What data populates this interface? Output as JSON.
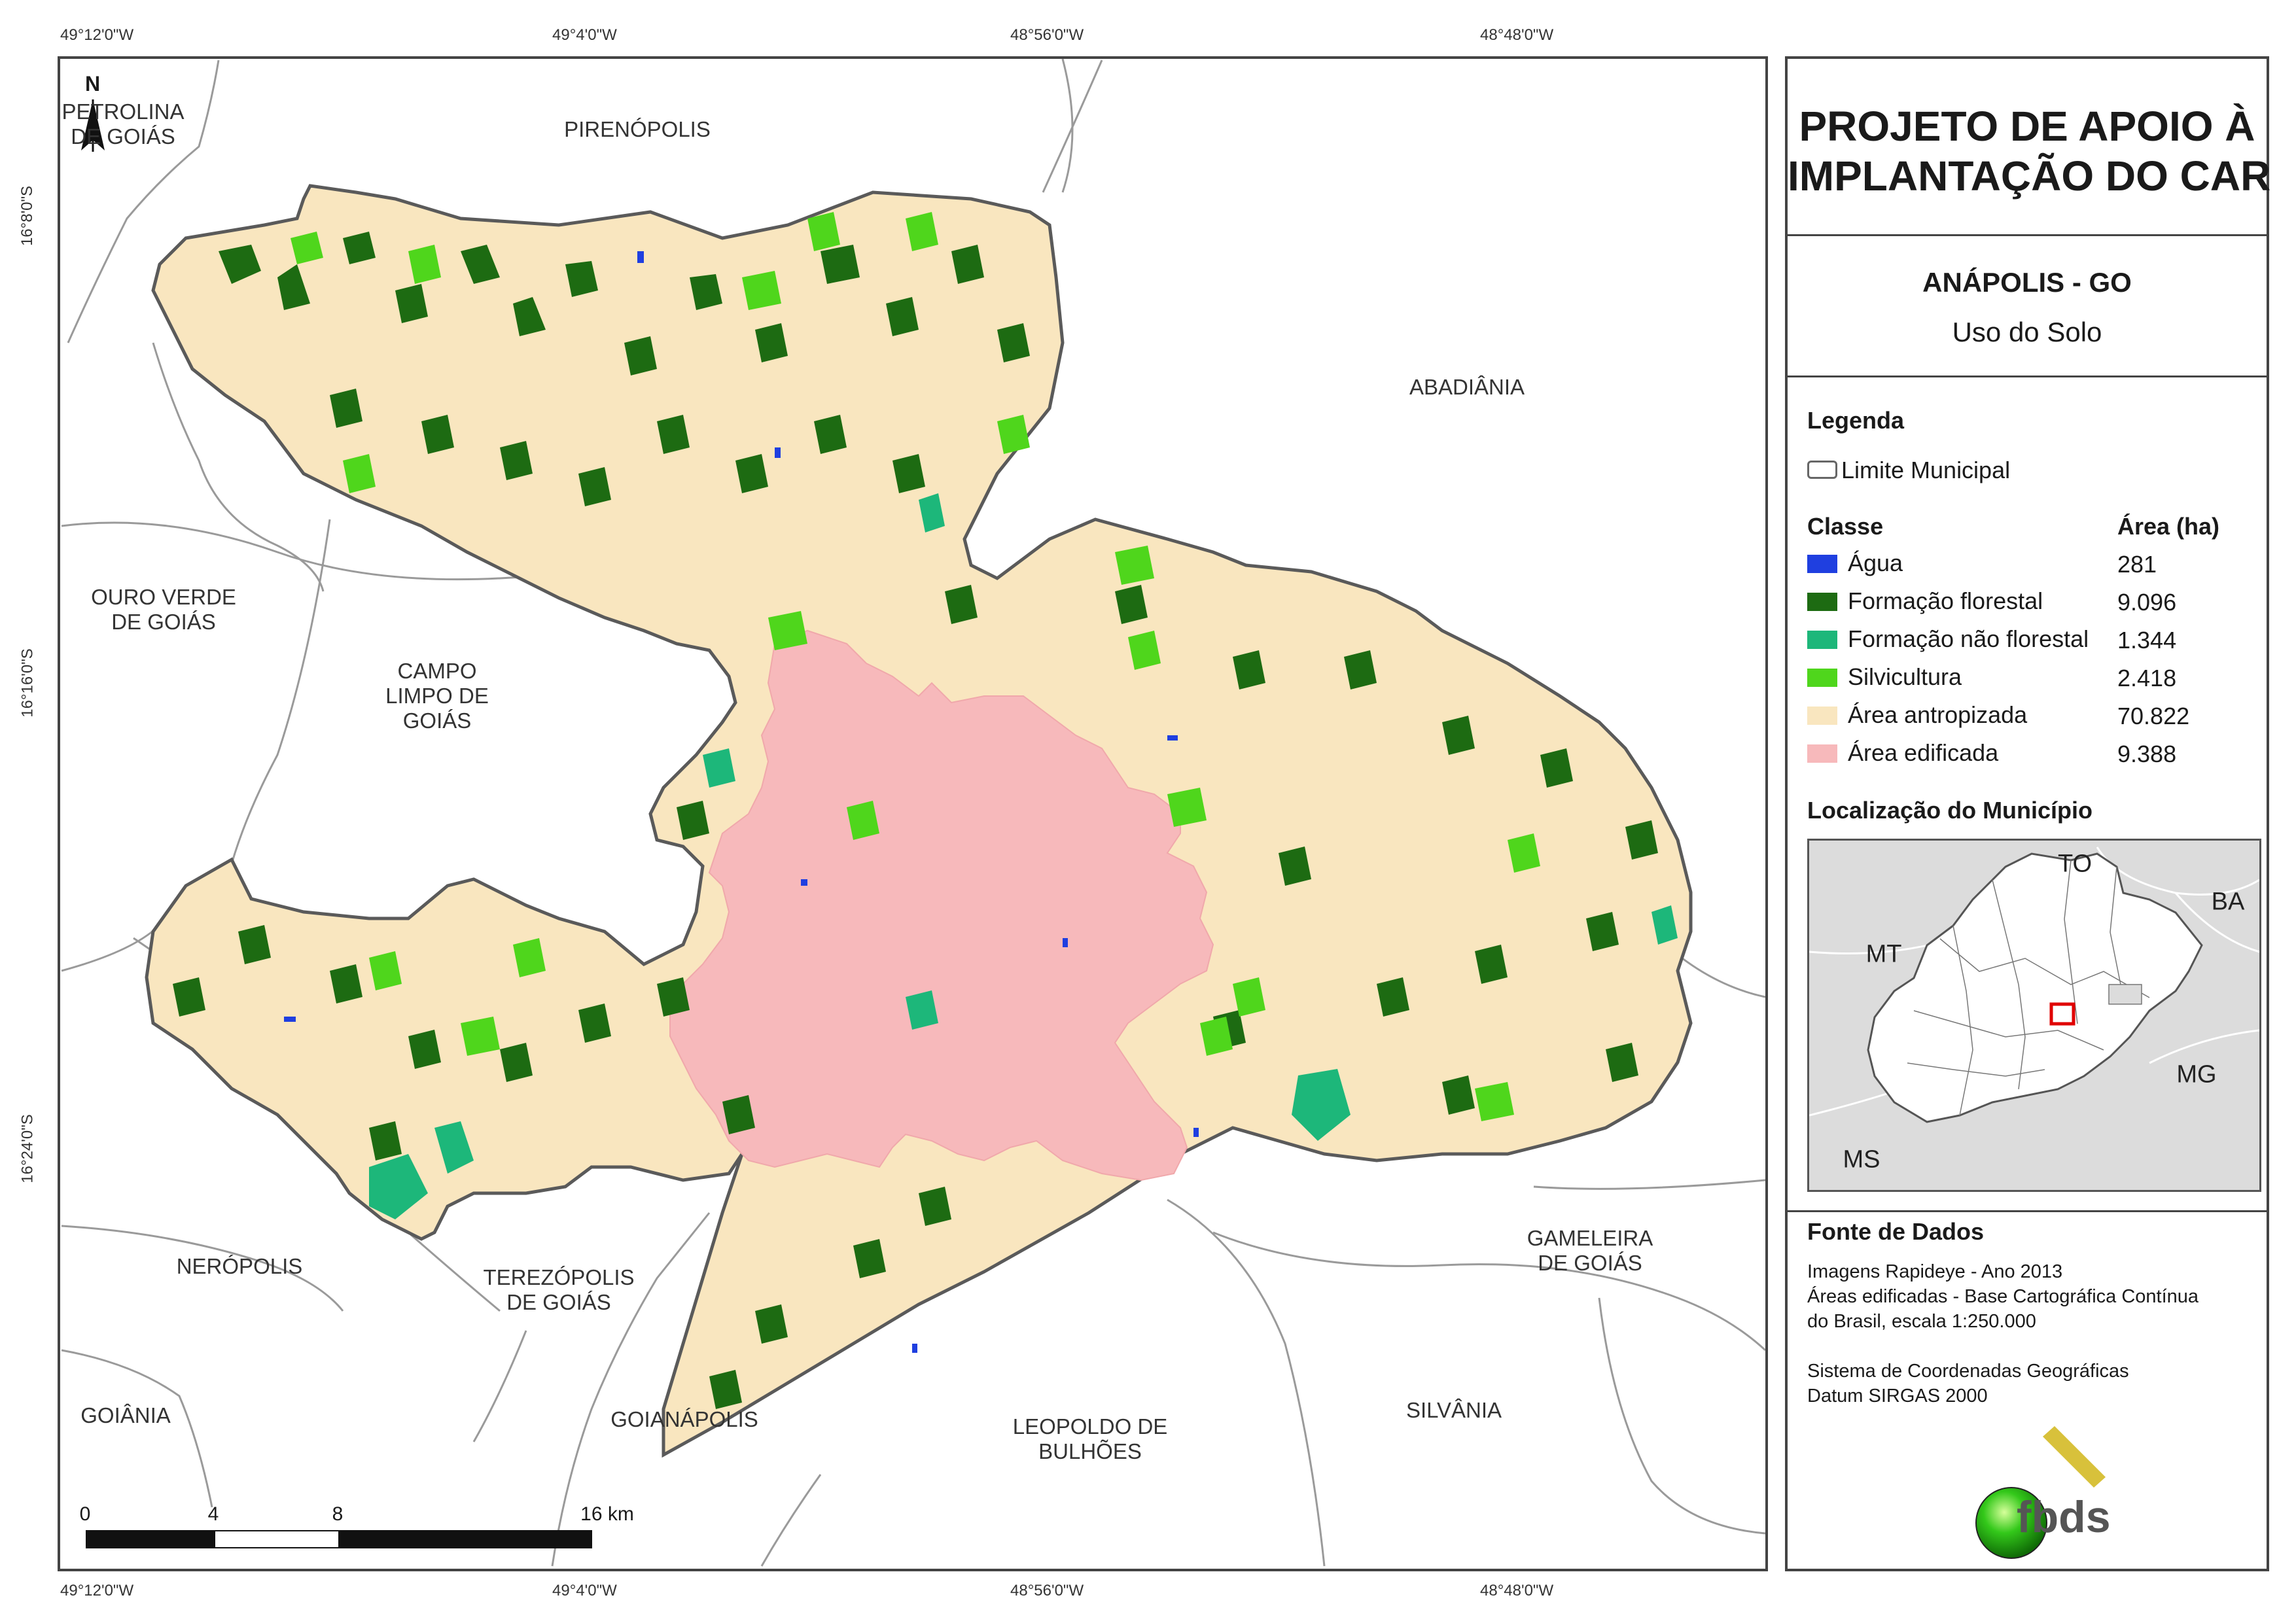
{
  "coordinates": {
    "top": [
      "49°12'0\"W",
      "49°4'0\"W",
      "48°56'0\"W",
      "48°48'0\"W"
    ],
    "bottom": [
      "49°12'0\"W",
      "49°4'0\"W",
      "48°56'0\"W",
      "48°48'0\"W"
    ],
    "left": [
      "16°8'0\"S",
      "16°16'0\"S",
      "16°24'0\"S"
    ]
  },
  "neighbors": {
    "petrolina": "PETROLINA\nDE GOIÁS",
    "pirenopolis": "PIRENÓPOLIS",
    "abadiania": "ABADIÂNIA",
    "ouro_verde": "OURO VERDE\nDE GOIÁS",
    "campo_limpo": "CAMPO\nLIMPO DE\nGOIÁS",
    "neropolis": "NERÓPOLIS",
    "terezopolis": "TEREZÓPOLIS\nDE GOIÁS",
    "gameleira": "GAMELEIRA\nDE GOIÁS",
    "goiania": "GOIÂNIA",
    "goianapolis": "GOIANÁPOLIS",
    "leopoldo": "LEOPOLDO DE\nBULHÕES",
    "silvania": "SILVÂNIA"
  },
  "north_arrow": "N",
  "scale_bar": {
    "labels": [
      "0",
      "4",
      "8",
      "16 km"
    ]
  },
  "panel": {
    "title": "PROJETO DE APOIO À\nIMPLANTAÇÃO DO CAR",
    "municipality": "ANÁPOLIS - GO",
    "theme": "Uso do Solo",
    "legend_heading": "Legenda",
    "boundary_label": "Limite Municipal",
    "class_heading": "Classe",
    "area_heading": "Área (ha)",
    "classes": [
      {
        "label": "Água",
        "area": "281",
        "color": "#1f3fe0"
      },
      {
        "label": "Formação florestal",
        "area": "9.096",
        "color": "#1d6b12"
      },
      {
        "label": "Formação não florestal",
        "area": "1.344",
        "color": "#1db77a"
      },
      {
        "label": "Silvicultura",
        "area": "2.418",
        "color": "#4fd61c"
      },
      {
        "label": "Área antropizada",
        "area": "70.822",
        "color": "#f9e6bf"
      },
      {
        "label": "Área edificada",
        "area": "9.388",
        "color": "#f7b9bb"
      }
    ],
    "location_heading": "Localização do Município",
    "inset_labels": {
      "to": "TO",
      "ba": "BA",
      "mt": "MT",
      "mg": "MG",
      "ms": "MS"
    },
    "source_heading": "Fonte de Dados",
    "source_lines": [
      "Imagens Rapideye - Ano 2013",
      "Áreas edificadas - Base Cartográfica Contínua",
      "do Brasil, escala 1:250.000"
    ],
    "crs_lines": [
      "Sistema de Coordenadas Geográficas",
      "Datum SIRGAS 2000"
    ],
    "logo_text": "fbds"
  },
  "colors": {
    "antropizada": "#f9e6bf",
    "edificada": "#f7b9bb",
    "florestal": "#1d6b12",
    "silvicultura": "#4fd61c",
    "nao_florestal": "#1db77a",
    "agua": "#1f3fe0",
    "inset_highlight": "#e00000"
  }
}
